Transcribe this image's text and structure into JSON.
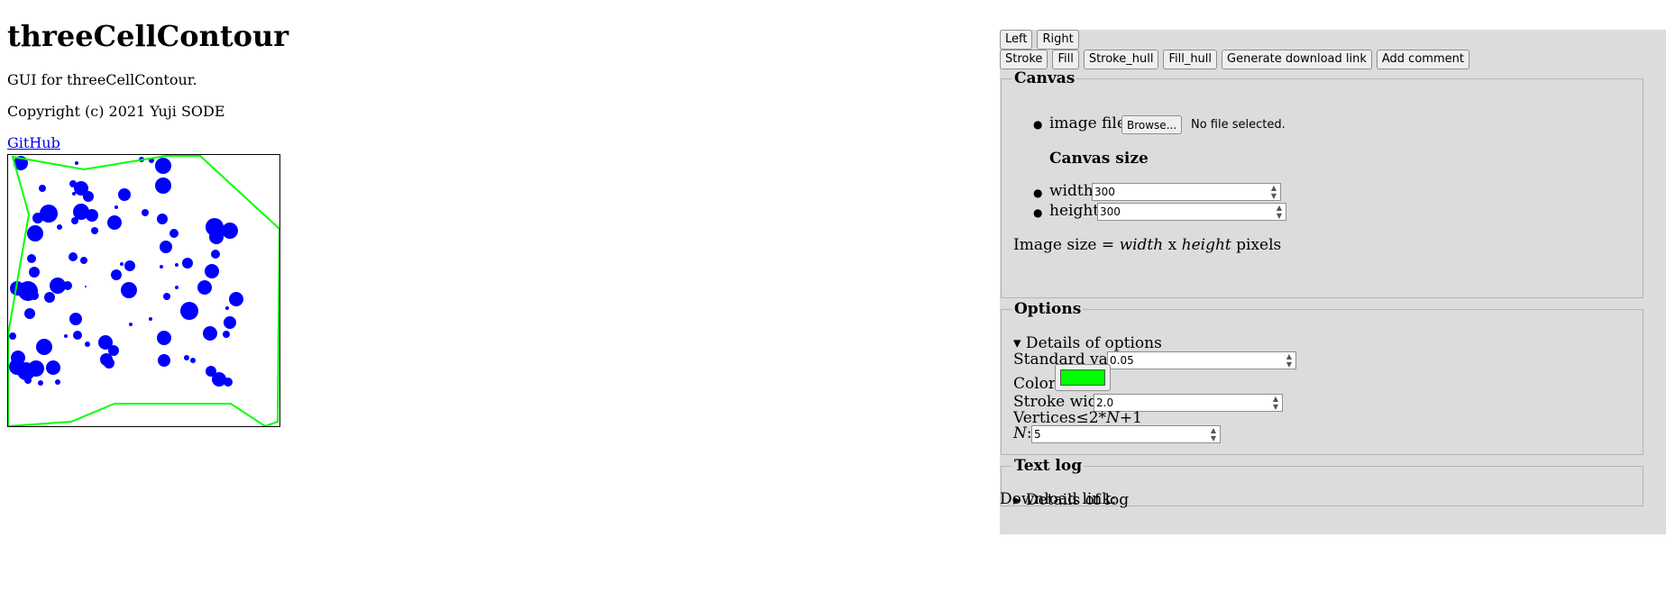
{
  "page": {
    "title": "threeCellContour",
    "description": "GUI for threeCellContour.",
    "copyright": "Copyright (c) 2021 Yuji SODE",
    "github_link": "GitHub"
  },
  "toolbar": {
    "row1": [
      "Left",
      "Right"
    ],
    "row2": [
      "Stroke",
      "Fill",
      "Stroke_hull",
      "Fill_hull",
      "Generate download link",
      "Add comment"
    ]
  },
  "canvas_section": {
    "legend": "Canvas",
    "image_file_label": "image file",
    "browse_label": "Browse...",
    "no_file_text": "No file selected.",
    "canvas_size_heading": "Canvas size",
    "width_label": "width",
    "width_value": "300",
    "height_label": "height",
    "height_value": "300",
    "image_size_prefix": "Image size = ",
    "image_size_w": "width",
    "image_size_x": " x ",
    "image_size_h": "height",
    "image_size_suffix": " pixels"
  },
  "options_section": {
    "legend": "Options",
    "details_summary": "▾ Details of options",
    "standard_value_label": "Standard value",
    "standard_value": "0.05",
    "color_label": "Color",
    "color_value": "#00ff00",
    "stroke_width_label": "Stroke width",
    "stroke_width_value": "2.0",
    "vertices_text_a": "Vertices≤2*",
    "vertices_text_n": "N",
    "vertices_text_b": "+1",
    "n_label": "N",
    "n_colon": ":",
    "n_value": "5"
  },
  "log_section": {
    "legend": "Text log",
    "details_summary": "▸ Details of log"
  },
  "download": {
    "label": "Download link:"
  },
  "colors": {
    "cell_fill": "#0000ff",
    "hull_stroke": "#00ff00",
    "panel_bg": "#dcdcdc"
  }
}
